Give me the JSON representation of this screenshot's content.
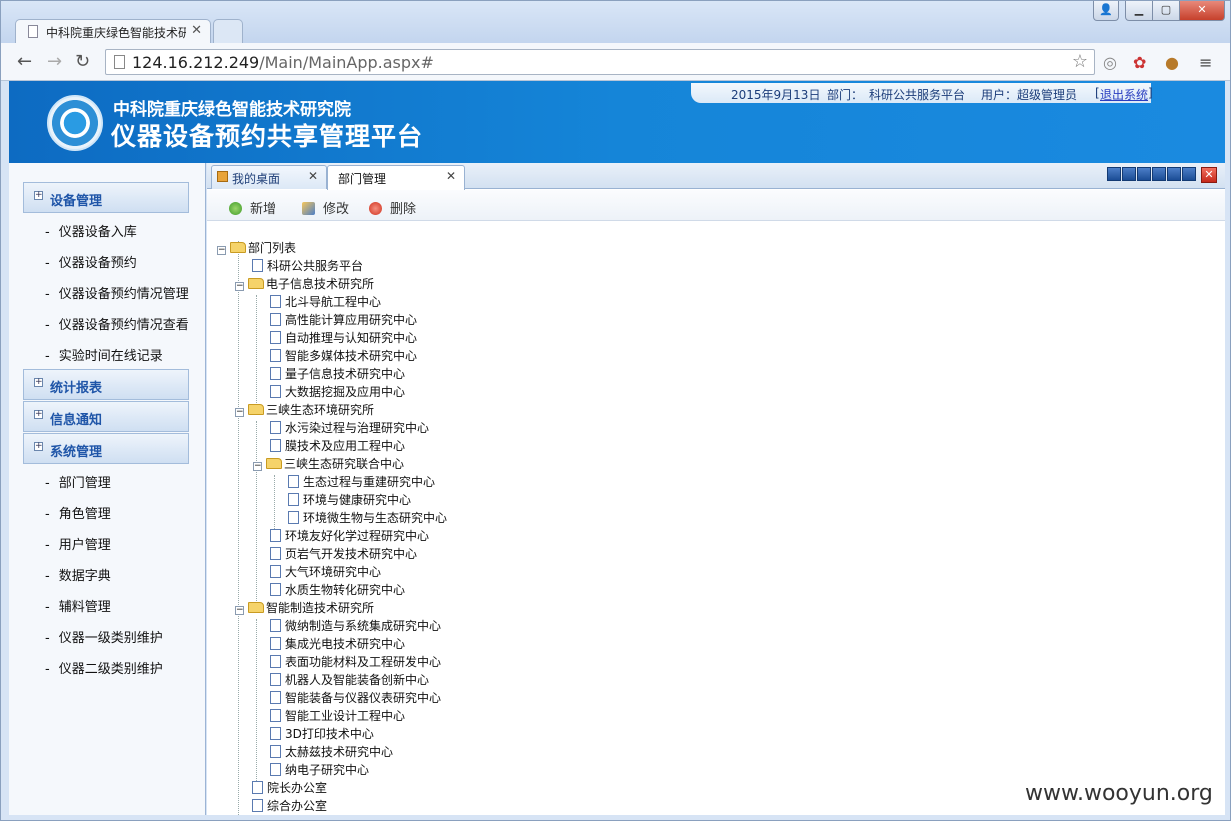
{
  "browser": {
    "tab_title": "中科院重庆绿色智能技术研",
    "tab_close": "✕",
    "url_host": "124.16.212.249",
    "url_path": "/Main/MainApp.aspx#",
    "window_buttons": {
      "user": "👤",
      "min": "▁",
      "max": "▢",
      "close": "✕"
    }
  },
  "header": {
    "org": "中科院重庆绿色智能技术研究院",
    "system": "仪器设备预约共享管理平台",
    "date": "2015年9月13日",
    "dept_label": "部门：",
    "dept_value": "科研公共服务平台",
    "user_label": "用户：",
    "user_value": "超级管理员",
    "logout_open": "[",
    "logout": "退出系统",
    "logout_close": "]"
  },
  "menu": {
    "groups": [
      {
        "label": "设备管理",
        "items": [
          "仪器设备入库",
          "仪器设备预约",
          "仪器设备预约情况管理",
          "仪器设备预约情况查看",
          "实验时间在线记录"
        ]
      },
      {
        "label": "统计报表"
      },
      {
        "label": "信息通知"
      },
      {
        "label": "系统管理",
        "items": [
          "部门管理",
          "角色管理",
          "用户管理",
          "数据字典",
          "辅料管理",
          "仪器一级类别维护",
          "仪器二级类别维护"
        ]
      }
    ]
  },
  "tabs": [
    {
      "label": "我的桌面"
    },
    {
      "label": "部门管理"
    }
  ],
  "toolbar": {
    "add": "新增",
    "edit": "修改",
    "delete": "删除"
  },
  "tree": {
    "root": "部门列表",
    "n1": "科研公共服务平台",
    "n2": "电子信息技术研究所",
    "n2_1": "北斗导航工程中心",
    "n2_2": "高性能计算应用研究中心",
    "n2_3": "自动推理与认知研究中心",
    "n2_4": "智能多媒体技术研究中心",
    "n2_5": "量子信息技术研究中心",
    "n2_6": "大数据挖掘及应用中心",
    "n3": "三峡生态环境研究所",
    "n3_1": "水污染过程与治理研究中心",
    "n3_2": "膜技术及应用工程中心",
    "n3_3": "三峡生态研究联合中心",
    "n3_3_1": "生态过程与重建研究中心",
    "n3_3_2": "环境与健康研究中心",
    "n3_3_3": "环境微生物与生态研究中心",
    "n3_4": "环境友好化学过程研究中心",
    "n3_5": "页岩气开发技术研究中心",
    "n3_6": "大气环境研究中心",
    "n3_7": "水质生物转化研究中心",
    "n4": "智能制造技术研究所",
    "n4_1": "微纳制造与系统集成研究中心",
    "n4_2": "集成光电技术研究中心",
    "n4_3": "表面功能材料及工程研发中心",
    "n4_4": "机器人及智能装备创新中心",
    "n4_5": "智能装备与仪器仪表研究中心",
    "n4_6": "智能工业设计工程中心",
    "n4_7": "3D打印技术中心",
    "n4_8": "太赫兹技术研究中心",
    "n4_9": "纳电子研究中心",
    "n5": "院长办公室",
    "n6": "综合办公室"
  },
  "watermark": "www.wooyun.org"
}
